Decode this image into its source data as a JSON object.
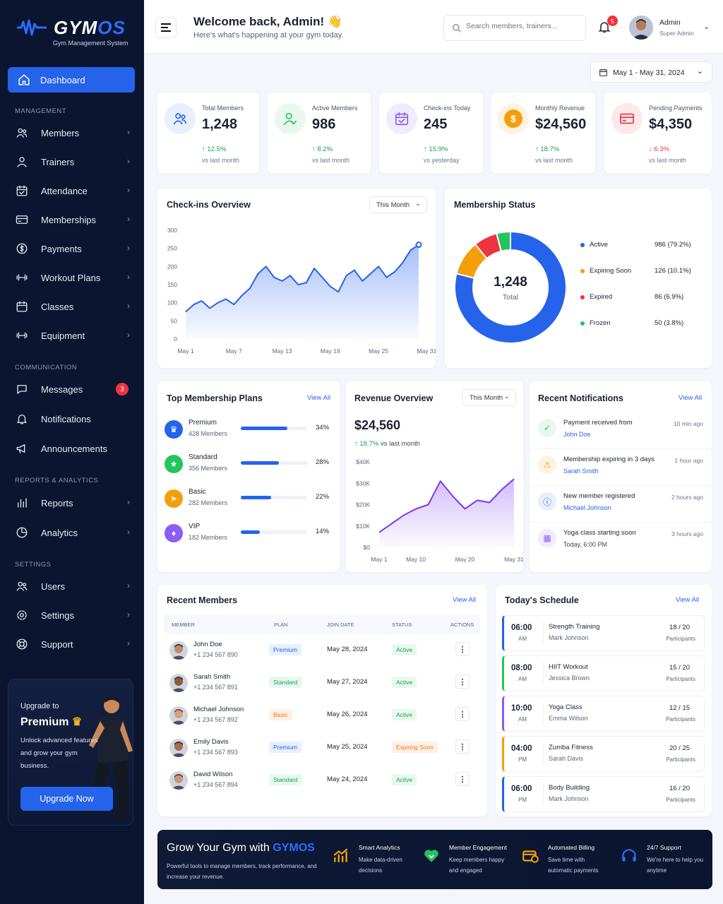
{
  "brand": {
    "name_a": "GYM",
    "name_b": "OS",
    "subtitle": "Gym Management System"
  },
  "nav": {
    "dashboard": "Dashboard",
    "management_title": "MANAGEMENT",
    "management": [
      "Members",
      "Trainers",
      "Attendance",
      "Memberships",
      "Payments",
      "Workout Plans",
      "Classes",
      "Equipment"
    ],
    "communication_title": "COMMUNICATION",
    "communication": [
      "Messages",
      "Notifications",
      "Announcements"
    ],
    "messages_badge": "3",
    "reports_title": "REPORTS & ANALYTICS",
    "reports": [
      "Reports",
      "Analytics"
    ],
    "settings_title": "SETTINGS",
    "settings": [
      "Users",
      "Settings",
      "Support"
    ]
  },
  "upgrade": {
    "line1": "Upgrade to",
    "line2": "Premium",
    "desc": "Unlock advanced features and grow your gym business.",
    "button": "Upgrade Now"
  },
  "header": {
    "title": "Welcome back, Admin! 👋",
    "subtitle": "Here's what's happening at your gym today.",
    "search_placeholder": "Search members, trainers...",
    "notif_count": "5",
    "user_name": "Admin",
    "user_role": "Super Admin"
  },
  "date_range": "May 1 - May 31, 2024",
  "stats": [
    {
      "label": "Total Members",
      "value": "1,248",
      "change": "↑ 12.5%",
      "sub": "vs last month",
      "dir": "up"
    },
    {
      "label": "Active Members",
      "value": "986",
      "change": "↑ 8.2%",
      "sub": "vs last month",
      "dir": "up"
    },
    {
      "label": "Check-ins Today",
      "value": "245",
      "change": "↑ 15.9%",
      "sub": "vs yesterday",
      "dir": "up"
    },
    {
      "label": "Monthly Revenue",
      "value": "$24,560",
      "change": "↑ 18.7%",
      "sub": "vs last month",
      "dir": "up"
    },
    {
      "label": "Pending Payments",
      "value": "$4,350",
      "change": "↓ 6.3%",
      "sub": "vs last month",
      "dir": "down"
    }
  ],
  "checkins": {
    "title": "Checkins Overview",
    "title_display": "Check-ins Overview",
    "filter": "This Month"
  },
  "membership_status": {
    "title": "Membership Status",
    "center_value": "1,248",
    "center_label": "Total"
  },
  "plans": {
    "title": "Top Membership Plans",
    "view_all": "View All",
    "items": [
      {
        "name": "Premium",
        "members": "428 Members",
        "pct": "34%",
        "value": 34,
        "color": "#2563eb"
      },
      {
        "name": "Standard",
        "members": "356 Members",
        "pct": "28%",
        "value": 28,
        "color": "#22c55e"
      },
      {
        "name": "Basic",
        "members": "282 Members",
        "pct": "22%",
        "value": 22,
        "color": "#f59e0b"
      },
      {
        "name": "VIP",
        "members": "182 Members",
        "pct": "14%",
        "value": 14,
        "color": "#8b5cf6"
      }
    ]
  },
  "revenue": {
    "title": "Revenue Overview",
    "filter": "This Month",
    "amount": "$24,560",
    "change": "↑ 18.7%",
    "change_sub": "vs last month"
  },
  "notifications": {
    "title": "Recent Notifications",
    "view_all": "View All",
    "items": [
      {
        "title": "Payment received from",
        "sub": "John Doe",
        "time": "10 min ago",
        "color": "#22c55e",
        "bg": "#e8f8ee",
        "icon": "check-circle-icon"
      },
      {
        "title": "Membership expiring in 3 days",
        "sub": "Sarah Smith",
        "time": "1 hour ago",
        "color": "#f59e0b",
        "bg": "#fef3e2",
        "icon": "warning-icon"
      },
      {
        "title": "New member registered",
        "sub": "Michael Johnson",
        "time": "2 hours ago",
        "color": "#2563eb",
        "bg": "#e8effd",
        "icon": "info-icon"
      },
      {
        "title": "Yoga class starting soon",
        "sub": "Today, 6:00 PM",
        "time": "3 hours ago",
        "color": "#8b5cf6",
        "bg": "#f1ebfe",
        "icon": "calendar-icon"
      }
    ]
  },
  "members": {
    "title": "Recent Members",
    "view_all": "View All",
    "headers": [
      "MEMBER",
      "PLAN",
      "JOIN DATE",
      "STATUS",
      "ACTIONS"
    ],
    "rows": [
      {
        "name": "John Doe",
        "phone": "+1 234 567 890",
        "plan": "Premium",
        "date": "May 28, 2024",
        "status": "Active"
      },
      {
        "name": "Sarah Smith",
        "phone": "+1 234 567 891",
        "plan": "Standard",
        "date": "May 27, 2024",
        "status": "Active"
      },
      {
        "name": "Michael Johnson",
        "phone": "+1 234 567 892",
        "plan": "Basic",
        "date": "May 26, 2024",
        "status": "Active"
      },
      {
        "name": "Emily Davis",
        "phone": "+1 234 567 893",
        "plan": "Premium",
        "date": "May 25, 2024",
        "status": "Expiring Soon"
      },
      {
        "name": "David Wilson",
        "phone": "+1 234 567 894",
        "plan": "Standard",
        "date": "May 24, 2024",
        "status": "Active"
      }
    ]
  },
  "schedule": {
    "title": "Today's Schedule",
    "view_all": "View All",
    "items": [
      {
        "time": "06:00",
        "ampm": "AM",
        "name": "Strength Training",
        "trainer": "Mark Johnson",
        "count": "18 / 20",
        "label": "Participants",
        "color": "#2563eb"
      },
      {
        "time": "08:00",
        "ampm": "AM",
        "name": "HIIT Workout",
        "trainer": "Jessica Brown",
        "count": "15 / 20",
        "label": "Participants",
        "color": "#22c55e"
      },
      {
        "time": "10:00",
        "ampm": "AM",
        "name": "Yoga Class",
        "trainer": "Emma Wilson",
        "count": "12 / 15",
        "label": "Participants",
        "color": "#8b5cf6"
      },
      {
        "time": "04:00",
        "ampm": "PM",
        "name": "Zumba Fitness",
        "trainer": "Sarah Davis",
        "count": "20 / 25",
        "label": "Participants",
        "color": "#f59e0b"
      },
      {
        "time": "06:00",
        "ampm": "PM",
        "name": "Body Building",
        "trainer": "Mark Johnson",
        "count": "16 / 20",
        "label": "Participants",
        "color": "#2563eb"
      }
    ]
  },
  "footer": {
    "title_a": "Grow Your Gym with ",
    "title_b": "GYMOS",
    "desc": "Powerful tools to manage members, track performance, and increase your revenue.",
    "features": [
      {
        "title": "Smart Analytics",
        "desc": "Make data-driven decisions",
        "icon": "chart-icon"
      },
      {
        "title": "Member Engagement",
        "desc": "Keep members happy and engaged",
        "icon": "heart-icon"
      },
      {
        "title": "Automated Billing",
        "desc": "Save time with automatic payments",
        "icon": "billing-icon"
      },
      {
        "title": "24/7 Support",
        "desc": "We're here to help you anytime",
        "icon": "headset-icon"
      }
    ]
  },
  "chart_data": [
    {
      "type": "area",
      "title": "Check-ins Overview",
      "x": [
        "May 1",
        "May 2",
        "May 3",
        "May 4",
        "May 5",
        "May 6",
        "May 7",
        "May 8",
        "May 9",
        "May 10",
        "May 11",
        "May 12",
        "May 13",
        "May 14",
        "May 15",
        "May 16",
        "May 17",
        "May 18",
        "May 19",
        "May 20",
        "May 21",
        "May 22",
        "May 23",
        "May 24",
        "May 25",
        "May 26",
        "May 27",
        "May 28",
        "May 29",
        "May 30",
        "May 31"
      ],
      "xticks": [
        "May 1",
        "May 7",
        "May 13",
        "May 19",
        "May 25",
        "May 31"
      ],
      "values": [
        75,
        95,
        105,
        85,
        100,
        110,
        95,
        120,
        140,
        180,
        200,
        170,
        160,
        175,
        150,
        155,
        195,
        170,
        145,
        130,
        175,
        190,
        160,
        180,
        200,
        170,
        185,
        210,
        245,
        260
      ],
      "yticks": [
        0,
        50,
        100,
        150,
        200,
        250,
        300
      ],
      "ylim": [
        0,
        300
      ]
    },
    {
      "type": "pie",
      "title": "Membership Status",
      "slices": [
        {
          "label": "Active",
          "value": 986,
          "text": "986 (79.2%)",
          "color": "#2563eb"
        },
        {
          "label": "Expiring Soon",
          "value": 126,
          "text": "126 (10.1%)",
          "color": "#f59e0b"
        },
        {
          "label": "Expired",
          "value": 86,
          "text": "86 (6.9%)",
          "color": "#ef3340"
        },
        {
          "label": "Frozen",
          "value": 50,
          "text": "50 (3.8%)",
          "color": "#22c55e"
        }
      ]
    },
    {
      "type": "area",
      "title": "Revenue Overview",
      "x": [
        "May 1",
        "May 4",
        "May 7",
        "May 10",
        "May 13",
        "May 16",
        "May 19",
        "May 20",
        "May 22",
        "May 25",
        "May 28",
        "May 31"
      ],
      "xticks": [
        "May 1",
        "May 10",
        "May 20",
        "May 31"
      ],
      "values": [
        7000,
        11000,
        15000,
        18000,
        20000,
        31000,
        24000,
        18000,
        22000,
        21000,
        27000,
        32000
      ],
      "yticks": [
        "$0",
        "$10K",
        "$20K",
        "$30K",
        "$40K"
      ],
      "ylim": [
        0,
        40000
      ]
    }
  ]
}
